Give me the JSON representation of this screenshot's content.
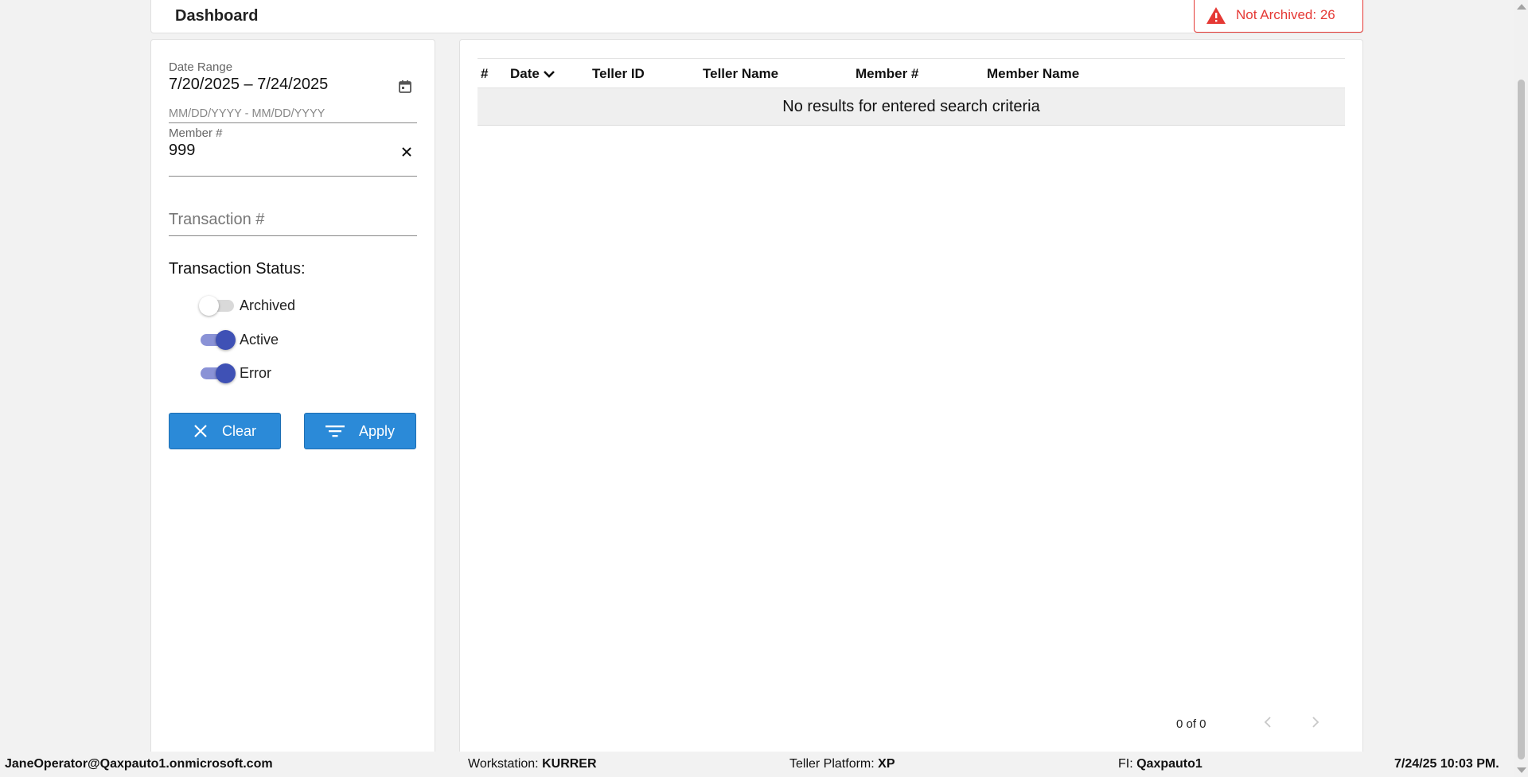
{
  "header": {
    "title": "Dashboard",
    "alert_text": "Not Archived: 26",
    "alert_color": "#e53935"
  },
  "filters": {
    "date_range": {
      "label": "Date Range",
      "value": "7/20/2025 – 7/24/2025",
      "hint": "MM/DD/YYYY - MM/DD/YYYY",
      "icon": "calendar-icon"
    },
    "member": {
      "label": "Member #",
      "value": "999",
      "icon": "close-icon"
    },
    "transaction": {
      "placeholder": "Transaction #"
    },
    "status": {
      "label": "Transaction Status:",
      "toggles": [
        {
          "label": "Archived",
          "on": false
        },
        {
          "label": "Active",
          "on": true
        },
        {
          "label": "Error",
          "on": true
        }
      ]
    },
    "buttons": {
      "clear_label": "Clear",
      "apply_label": "Apply",
      "color": "#2b8ad8"
    }
  },
  "table": {
    "columns": [
      "#",
      "Date",
      "Teller ID",
      "Teller Name",
      "Member #",
      "Member Name"
    ],
    "sort_column": "Date",
    "empty_message": "No results for entered search criteria"
  },
  "pagination": {
    "text": "0 of 0",
    "prev_icon": "chevron-left-icon",
    "next_icon": "chevron-right-icon"
  },
  "footer": {
    "user": "JaneOperator@Qaxpauto1.onmicrosoft.com",
    "workstation_label": "Workstation: ",
    "workstation_value": "KURRER",
    "platform_label": "Teller Platform: ",
    "platform_value": "XP",
    "fi_label": "FI: ",
    "fi_value": "Qaxpauto1",
    "datetime": "7/24/25 10:03 PM."
  }
}
